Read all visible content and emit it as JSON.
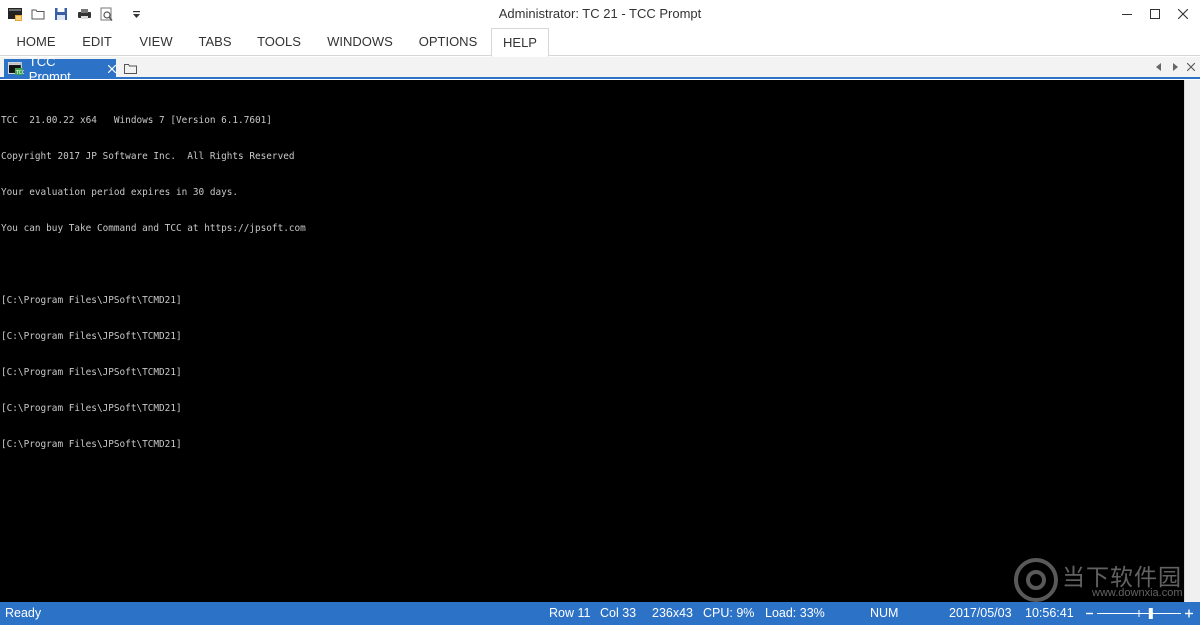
{
  "window": {
    "title": "Administrator: TC 21 - TCC Prompt"
  },
  "quick_access": {
    "icons": [
      "app-icon",
      "open-folder-icon",
      "save-icon",
      "print-icon",
      "print-preview-icon",
      "customize-dropdown-icon"
    ]
  },
  "ribbon": {
    "tabs": [
      {
        "label": "HOME"
      },
      {
        "label": "EDIT"
      },
      {
        "label": "VIEW"
      },
      {
        "label": "TABS"
      },
      {
        "label": "TOOLS"
      },
      {
        "label": "WINDOWS"
      },
      {
        "label": "OPTIONS"
      },
      {
        "label": "HELP",
        "active": true
      }
    ]
  },
  "doc_tabs": {
    "active_tab": {
      "label": "TCC Prompt"
    }
  },
  "console": {
    "lines": [
      "TCC  21.00.22 x64   Windows 7 [Version 6.1.7601]",
      "Copyright 2017 JP Software Inc.  All Rights Reserved",
      "Your evaluation period expires in 30 days.",
      "You can buy Take Command and TCC at https://jpsoft.com",
      "",
      "[C:\\Program Files\\JPSoft\\TCMD21]",
      "[C:\\Program Files\\JPSoft\\TCMD21]",
      "[C:\\Program Files\\JPSoft\\TCMD21]",
      "[C:\\Program Files\\JPSoft\\TCMD21]",
      "[C:\\Program Files\\JPSoft\\TCMD21]"
    ]
  },
  "watermark": {
    "text": "当下软件园",
    "url": "www.downxia.com"
  },
  "status": {
    "ready": "Ready",
    "row": "Row 11",
    "col": "Col 33",
    "size": "236x43",
    "cpu": "CPU:  9%",
    "load": "Load: 33%",
    "num": "NUM",
    "date": "2017/05/03",
    "time": "10:56:41",
    "zoom_level": 0.64
  },
  "colors": {
    "accent": "#2c72c7",
    "console_bg": "#000000",
    "console_fg": "#c8c8c8"
  }
}
